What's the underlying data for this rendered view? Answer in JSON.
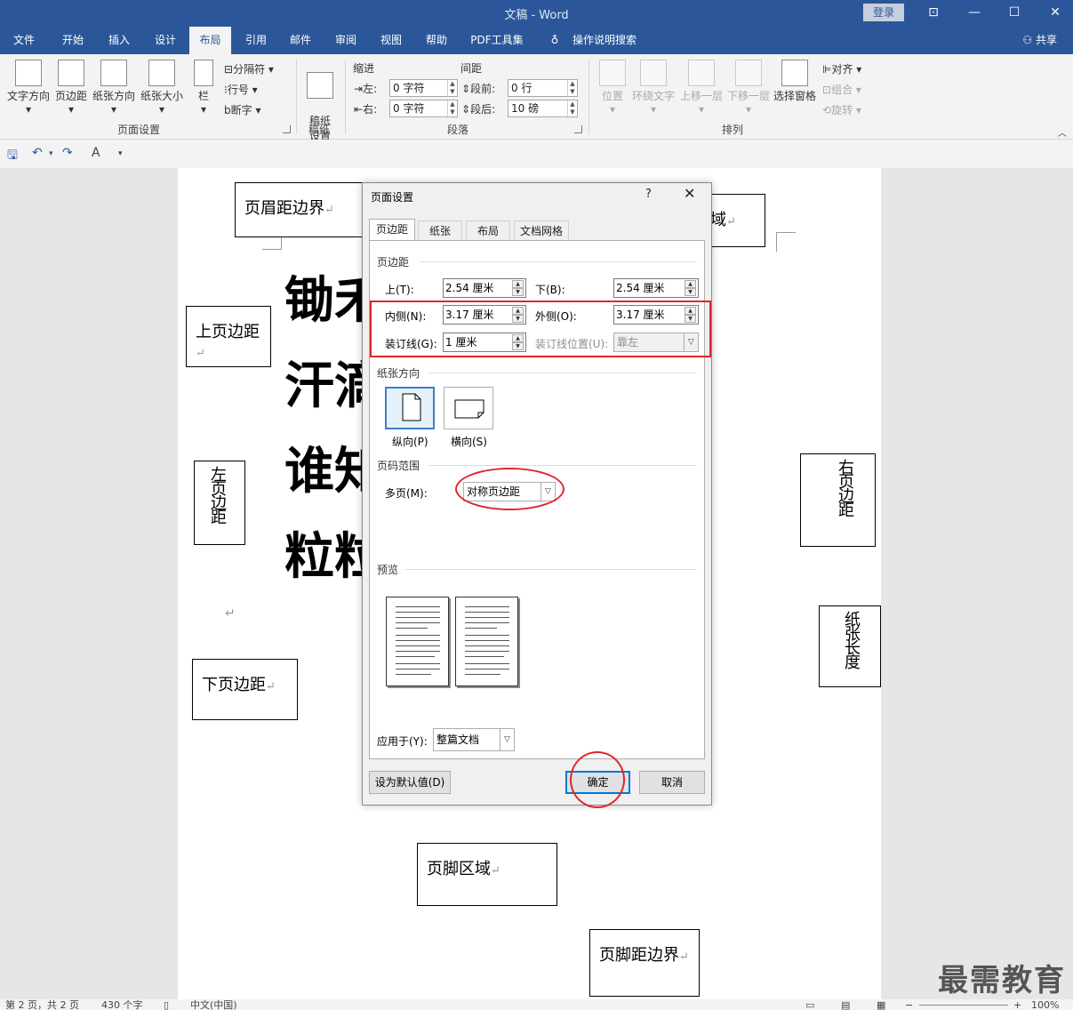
{
  "window": {
    "title": "文稿 - Word",
    "login": "登录",
    "share": "共享"
  },
  "tabs": [
    "文件",
    "开始",
    "插入",
    "设计",
    "布局",
    "引用",
    "邮件",
    "审阅",
    "视图",
    "帮助",
    "PDF工具集",
    "操作说明搜索"
  ],
  "ribbon": {
    "page_setup": {
      "label": "页面设置",
      "text_direction": "文字方向",
      "margins": "页边距",
      "orientation": "纸张方向",
      "size": "纸张大小",
      "columns": "栏",
      "breaks": "分隔符",
      "line_numbers": "行号",
      "hyphenation": "断字"
    },
    "manuscript": {
      "label": "稿纸",
      "button": "稿纸\n设置"
    },
    "paragraph": {
      "label": "段落",
      "indent": "缩进",
      "spacing": "间距",
      "left_label": "左:",
      "left_value": "0 字符",
      "right_label": "右:",
      "right_value": "0 字符",
      "before_label": "段前:",
      "before_value": "0 行",
      "after_label": "段后:",
      "after_value": "10 磅"
    },
    "arrange": {
      "label": "排列",
      "position": "位置",
      "wrap_text": "环绕文字",
      "bring_forward": "上移一层",
      "send_backward": "下移一层",
      "selection_pane": "选择窗格",
      "align": "对齐",
      "group": "组合",
      "rotate": "旋转"
    }
  },
  "document": {
    "header_boundary": "页眉距边界",
    "header_area_partial": "域",
    "top_margin": "上页边距",
    "left_margin": "左页边距",
    "right_margin": "右页边距",
    "paper_height": "纸张长度",
    "bottom_margin": "下页边距",
    "footer_area": "页脚区域",
    "footer_boundary": "页脚距边界",
    "paragraph_mark": "↵",
    "lines": [
      "锄禾",
      "汗滴",
      "谁知",
      "粒粒"
    ]
  },
  "dialog": {
    "title": "页面设置",
    "help": "?",
    "close": "✕",
    "tabs": [
      "页边距",
      "纸张",
      "布局",
      "文档网格"
    ],
    "margins_section": "页边距",
    "top_label": "上(T):",
    "top_value": "2.54 厘米",
    "bottom_label": "下(B):",
    "bottom_value": "2.54 厘米",
    "inside_label": "内侧(N):",
    "inside_value": "3.17 厘米",
    "outside_label": "外侧(O):",
    "outside_value": "3.17 厘米",
    "gutter_label": "装订线(G):",
    "gutter_value": "1 厘米",
    "gutter_pos_label": "装订线位置(U):",
    "gutter_pos_value": "靠左",
    "orientation_section": "纸张方向",
    "portrait": "纵向(P)",
    "landscape": "横向(S)",
    "pages_section": "页码范围",
    "multiple_label": "多页(M):",
    "multiple_value": "对称页边距",
    "preview_section": "预览",
    "apply_label": "应用于(Y):",
    "apply_value": "整篇文档",
    "set_default": "设为默认值(D)",
    "ok": "确定",
    "cancel": "取消"
  },
  "status": {
    "page": "第 2 页，共 2 页",
    "words": "430 个字",
    "language": "中文(中国)",
    "zoom": "100%"
  },
  "watermark": "最需教育",
  "colors": {
    "accent": "#2b579a",
    "annotation": "#e0262b"
  }
}
